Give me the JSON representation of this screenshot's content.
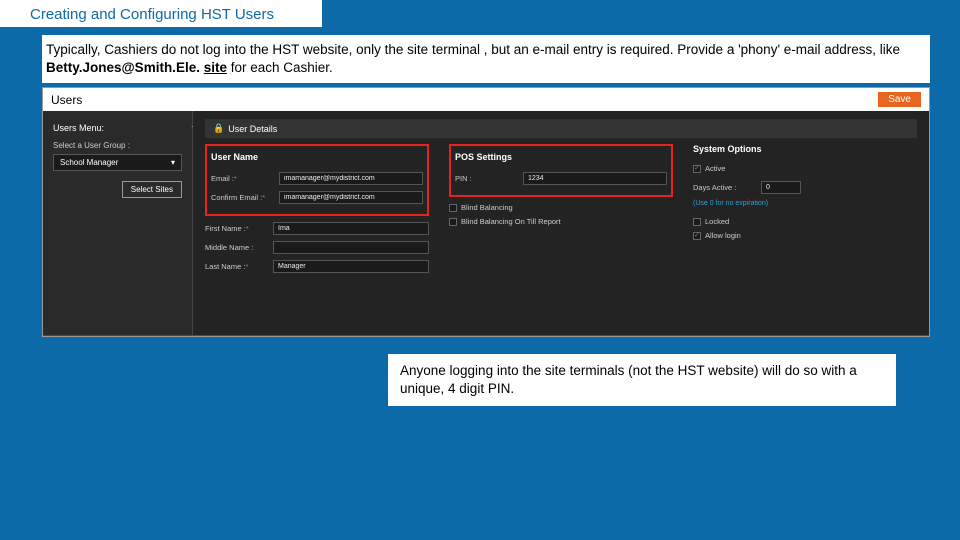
{
  "title": "Creating and Configuring HST Users",
  "subtitle_parts": {
    "a": "Typically, Cashiers do not log into the HST website, only the site terminal , but an e-mail entry is required. Provide a 'phony'  e-mail address, like ",
    "b": "Betty.Jones@Smith.Ele.",
    "c": "site",
    "d": " for each Cashier."
  },
  "app": {
    "header": "Users",
    "save": "Save",
    "sidebar": {
      "menu_title": "Users Menu:",
      "group_label": "Select a User Group :",
      "group_value": "School Manager",
      "select_sites": "Select Sites"
    },
    "details": {
      "panel_title": "User Details",
      "user_name": "User Name",
      "email_label": "Email :",
      "email_value": "imamanager@mydistrict.com",
      "confirm_label": "Confirm Email :",
      "confirm_value": "imamanager@mydistrict.com",
      "first_label": "First Name :",
      "first_value": "Ima",
      "middle_label": "Middle Name :",
      "last_label": "Last Name :",
      "last_value": "Manager"
    },
    "pos": {
      "title": "POS Settings",
      "pin_label": "PIN :",
      "pin_value": "1234",
      "blind1": "Blind Balancing",
      "blind2": "Blind Balancing On Till Report"
    },
    "system": {
      "title": "System Options",
      "active": "Active",
      "days_label": "Days Active :",
      "days_value": "0",
      "days_hint": "(Use 0 for no expiration)",
      "locked": "Locked",
      "allow": "Allow login"
    }
  },
  "callout": "Anyone logging into the site terminals (not the HST website) will do so with a unique, 4 digit PIN."
}
